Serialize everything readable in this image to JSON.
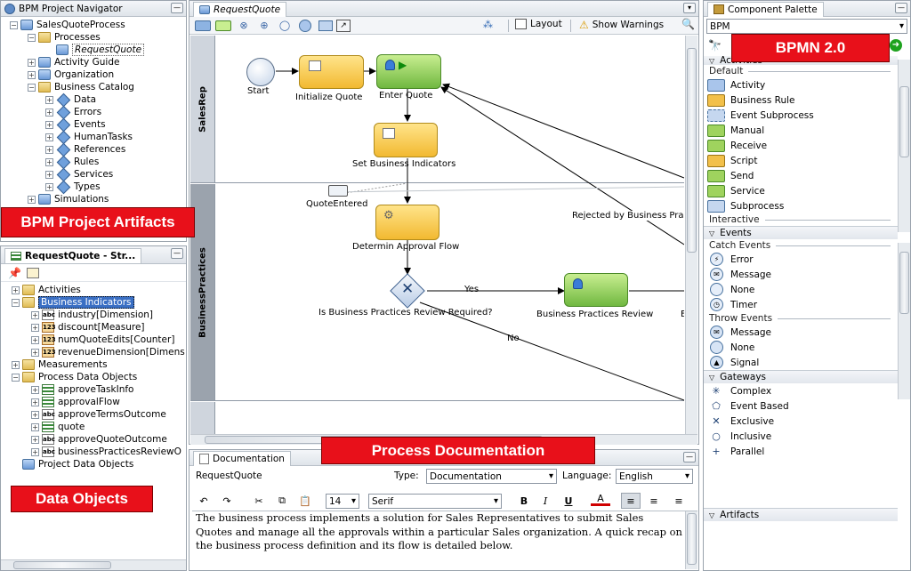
{
  "navigator": {
    "title": "BPM Project Navigator",
    "items": [
      {
        "label": "SalesQuoteProcess",
        "level": 0,
        "exp": "−"
      },
      {
        "label": "Processes",
        "level": 1,
        "exp": "−"
      },
      {
        "label": "RequestQuote",
        "level": 2,
        "exp": ""
      },
      {
        "label": "Activity Guide",
        "level": 1,
        "exp": "+"
      },
      {
        "label": "Organization",
        "level": 1,
        "exp": "+"
      },
      {
        "label": "Business Catalog",
        "level": 1,
        "exp": "−"
      },
      {
        "label": "Data",
        "level": 2,
        "exp": "+"
      },
      {
        "label": "Errors",
        "level": 2,
        "exp": "+"
      },
      {
        "label": "Events",
        "level": 2,
        "exp": "+"
      },
      {
        "label": "HumanTasks",
        "level": 2,
        "exp": "+"
      },
      {
        "label": "References",
        "level": 2,
        "exp": "+"
      },
      {
        "label": "Rules",
        "level": 2,
        "exp": "+"
      },
      {
        "label": "Services",
        "level": 2,
        "exp": "+"
      },
      {
        "label": "Types",
        "level": 2,
        "exp": "+"
      },
      {
        "label": "Simulations",
        "level": 1,
        "exp": "+"
      }
    ]
  },
  "structure": {
    "title": "RequestQuote - Str...",
    "items": [
      {
        "label": "Activities",
        "level": 0,
        "exp": "+",
        "icon": "folder"
      },
      {
        "label": "Business Indicators",
        "level": 0,
        "exp": "−",
        "icon": "folder",
        "selected": true
      },
      {
        "label": "industry[Dimension]",
        "level": 1,
        "exp": "+",
        "icon": "abc"
      },
      {
        "label": "discount[Measure]",
        "level": 1,
        "exp": "+",
        "icon": "num"
      },
      {
        "label": "numQuoteEdits[Counter]",
        "level": 1,
        "exp": "+",
        "icon": "num"
      },
      {
        "label": "revenueDimension[Dimens",
        "level": 1,
        "exp": "+",
        "icon": "num"
      },
      {
        "label": "Measurements",
        "level": 0,
        "exp": "+",
        "icon": "folder"
      },
      {
        "label": "Process Data Objects",
        "level": 0,
        "exp": "−",
        "icon": "folder"
      },
      {
        "label": "approveTaskInfo",
        "level": 1,
        "exp": "+",
        "icon": "list"
      },
      {
        "label": "approvalFlow",
        "level": 1,
        "exp": "+",
        "icon": "list"
      },
      {
        "label": "approveTermsOutcome",
        "level": 1,
        "exp": "+",
        "icon": "abc"
      },
      {
        "label": "quote",
        "level": 1,
        "exp": "+",
        "icon": "list"
      },
      {
        "label": "approveQuoteOutcome",
        "level": 1,
        "exp": "+",
        "icon": "abc"
      },
      {
        "label": "businessPracticesReviewO",
        "level": 1,
        "exp": "+",
        "icon": "abc"
      },
      {
        "label": "Project Data Objects",
        "level": 0,
        "exp": "",
        "icon": "blue"
      }
    ]
  },
  "labels": {
    "artifacts": "BPM Project Artifacts",
    "dataobjects": "Data Objects",
    "procdoc": "Process Documentation",
    "bpmn": "BPMN 2.0"
  },
  "editor": {
    "tab": "RequestQuote",
    "layout": "Layout",
    "warnings": "Show Warnings"
  },
  "diagram": {
    "lanes": [
      "SalesRep",
      "BusinessPractices"
    ],
    "start": "Start",
    "initialize": "Initialize Quote",
    "enter": "Enter Quote",
    "setbi": "Set Business Indicators",
    "quoteentered": "QuoteEntered",
    "determine": "Determin Approval Flow",
    "gateway": "Is Business Practices Review Required?",
    "bpreview": "Business Practices Review",
    "yes": "Yes",
    "no": "No",
    "rejected": "Rejected by Business Pra",
    "cut": "E"
  },
  "documentation": {
    "tab": "Documentation",
    "process": "RequestQuote",
    "type_label": "Type:",
    "type_value": "Documentation",
    "lang_label": "Language:",
    "lang_value": "English",
    "font_size": "14",
    "font_name": "Serif",
    "text": "The business process implements a solution for Sales Representatives to submit Sales Quotes and manage all the approvals within a particular Sales organization. A quick recap on the business process definition and its flow is detailed below."
  },
  "palette": {
    "title": "Component Palette",
    "selector": "BPM",
    "sections": {
      "activities": "Activities",
      "default": "Default",
      "interactive": "Interactive",
      "events": "Events",
      "catch": "Catch Events",
      "throw": "Throw Events",
      "gateways": "Gateways",
      "artifacts": "Artifacts"
    },
    "default_items": [
      "Activity",
      "Business Rule",
      "Event Subprocess",
      "Manual",
      "Receive",
      "Script",
      "Send",
      "Service",
      "Subprocess"
    ],
    "catch_items": [
      "Error",
      "Message",
      "None",
      "Timer"
    ],
    "throw_items": [
      "Message",
      "None",
      "Signal"
    ],
    "gateway_items": [
      "Complex",
      "Event Based",
      "Exclusive",
      "Inclusive",
      "Parallel"
    ]
  },
  "colors": {
    "accent": "#e8101a",
    "task_yellow": "#f2b931",
    "task_green": "#70b840"
  }
}
